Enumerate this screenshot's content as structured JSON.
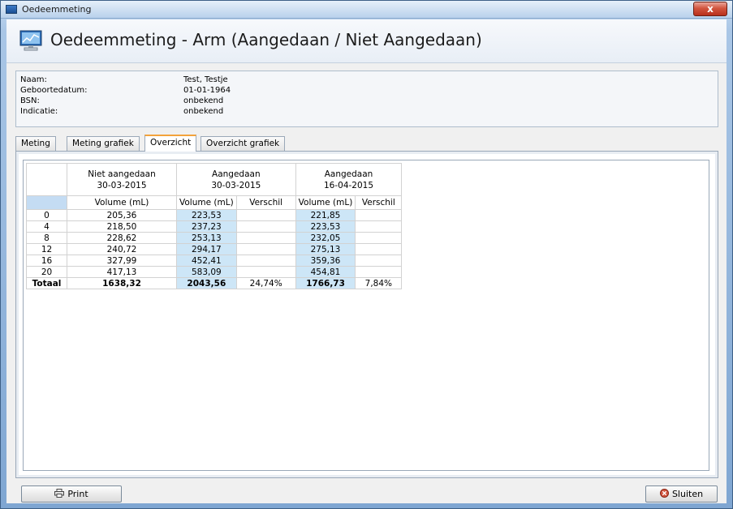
{
  "window": {
    "title": "Oedeemmeting",
    "close_label": "x"
  },
  "header": {
    "title": "Oedeemmeting - Arm (Aangedaan / Niet Aangedaan)"
  },
  "patient": [
    {
      "label": "Naam:",
      "value": "Test, Testje"
    },
    {
      "label": "Geboortedatum:",
      "value": "01-01-1964"
    },
    {
      "label": "BSN:",
      "value": "onbekend"
    },
    {
      "label": "Indicatie:",
      "value": "onbekend"
    }
  ],
  "tabs": [
    {
      "label": "Meting",
      "active": false
    },
    {
      "label": "Meting grafiek",
      "active": false
    },
    {
      "label": "Overzicht",
      "active": true
    },
    {
      "label": "Overzicht grafiek",
      "active": false
    }
  ],
  "table": {
    "groups": [
      {
        "line1": "Niet aangedaan",
        "line2": "30-03-2015"
      },
      {
        "line1": "Aangedaan",
        "line2": "30-03-2015"
      },
      {
        "line1": "Aangedaan",
        "line2": "16-04-2015"
      }
    ],
    "subheaders": [
      "Volume (mL)",
      "Volume (mL)",
      "Verschil",
      "Volume (mL)",
      "Verschil"
    ],
    "rows": [
      {
        "label": "0",
        "v1": "205,36",
        "v2": "223,53",
        "d2": "",
        "v3": "221,85",
        "d3": ""
      },
      {
        "label": "4",
        "v1": "218,50",
        "v2": "237,23",
        "d2": "",
        "v3": "223,53",
        "d3": ""
      },
      {
        "label": "8",
        "v1": "228,62",
        "v2": "253,13",
        "d2": "",
        "v3": "232,05",
        "d3": ""
      },
      {
        "label": "12",
        "v1": "240,72",
        "v2": "294,17",
        "d2": "",
        "v3": "275,13",
        "d3": ""
      },
      {
        "label": "16",
        "v1": "327,99",
        "v2": "452,41",
        "d2": "",
        "v3": "359,36",
        "d3": ""
      },
      {
        "label": "20",
        "v1": "417,13",
        "v2": "583,09",
        "d2": "",
        "v3": "454,81",
        "d3": ""
      }
    ],
    "total": {
      "label": "Totaal",
      "v1": "1638,32",
      "v2": "2043,56",
      "d2": "24,74%",
      "v3": "1766,73",
      "d3": "7,84%"
    }
  },
  "buttons": {
    "print": "Print",
    "close": "Sluiten"
  },
  "colors": {
    "accent_tab": "#f3a23b",
    "cell_highlight": "#cde6f7",
    "close_button": "#c8412b"
  }
}
